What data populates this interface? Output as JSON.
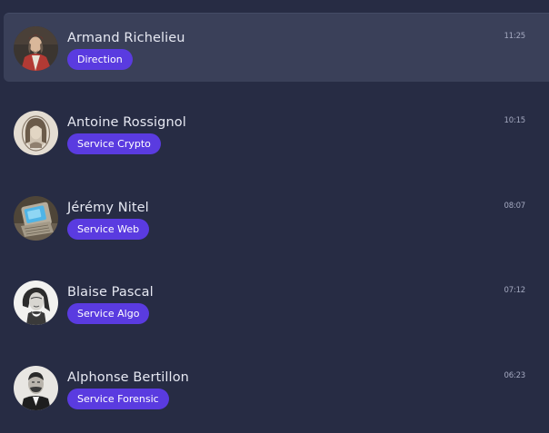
{
  "contacts": [
    {
      "name": "Armand Richelieu",
      "tag": "Direction",
      "time": "11:25",
      "avatar": "portrait-richelieu",
      "selected": true
    },
    {
      "name": "Antoine Rossignol",
      "tag": "Service Crypto",
      "time": "10:15",
      "avatar": "portrait-rossignol",
      "selected": false
    },
    {
      "name": "Jérémy Nitel",
      "tag": "Service Web",
      "time": "08:07",
      "avatar": "retro-computer",
      "selected": false
    },
    {
      "name": "Blaise Pascal",
      "tag": "Service Algo",
      "time": "07:12",
      "avatar": "portrait-pascal",
      "selected": false
    },
    {
      "name": "Alphonse Bertillon",
      "tag": "Service Forensic",
      "time": "06:23",
      "avatar": "portrait-bertillon",
      "selected": false
    }
  ],
  "colors": {
    "background": "#272c44",
    "selected_row": "#3a4059",
    "badge": "#5a3be0"
  }
}
